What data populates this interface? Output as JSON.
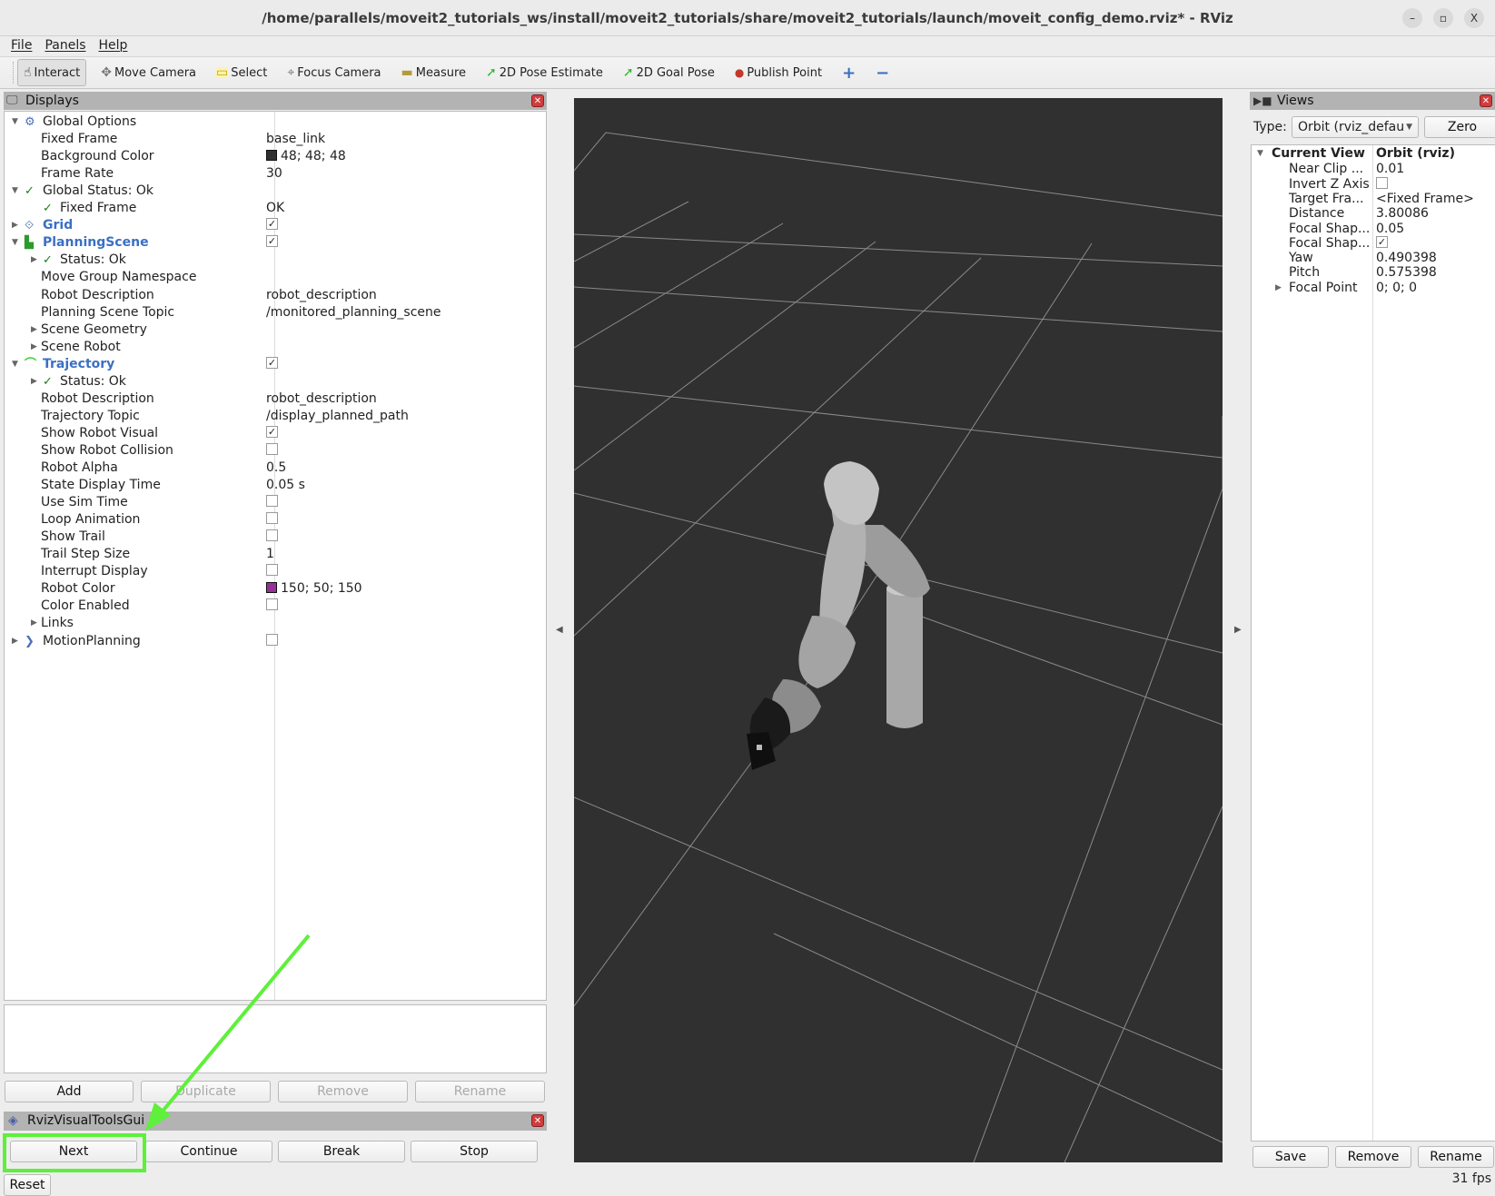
{
  "window": {
    "title": "/home/parallels/moveit2_tutorials_ws/install/moveit2_tutorials/share/moveit2_tutorials/launch/moveit_config_demo.rviz* - RViz",
    "controls": {
      "minimize": "–",
      "maximize": "▫",
      "close": "X"
    }
  },
  "menu": [
    "File",
    "Panels",
    "Help"
  ],
  "toolbar": {
    "tools": [
      {
        "label": "Interact",
        "icon": "hand-pointer-icon",
        "glyph": "☝",
        "active": true
      },
      {
        "label": "Move Camera",
        "icon": "move-camera-icon",
        "glyph": "✥"
      },
      {
        "label": "Select",
        "icon": "select-box-icon",
        "glyph": "▭"
      },
      {
        "label": "Focus Camera",
        "icon": "focus-camera-icon",
        "glyph": "⌖"
      },
      {
        "label": "Measure",
        "icon": "ruler-icon",
        "glyph": "▬"
      },
      {
        "label": "2D Pose Estimate",
        "icon": "pose-arrow-icon",
        "glyph": "➚"
      },
      {
        "label": "2D Goal Pose",
        "icon": "goal-arrow-icon",
        "glyph": "➚"
      },
      {
        "label": "Publish Point",
        "icon": "map-pin-icon",
        "glyph": "📍"
      }
    ],
    "add_tool": "+",
    "remove_tool": "−"
  },
  "displays": {
    "title": "Displays",
    "rows": [
      {
        "level": 0,
        "arrow": "▼",
        "icon": "gear-icon",
        "glyph": "⚙",
        "label": "Global Options",
        "style": "normal"
      },
      {
        "level": 1,
        "label": "Fixed Frame",
        "value": "base_link"
      },
      {
        "level": 1,
        "label": "Background Color",
        "value": "48; 48; 48",
        "swatch": "#303030"
      },
      {
        "level": 1,
        "label": "Frame Rate",
        "value": "30"
      },
      {
        "level": 0,
        "arrow": "▼",
        "icon": "check-icon",
        "glyph": "✓",
        "label": "Global Status: Ok",
        "style": "normal"
      },
      {
        "level": 1,
        "icon": "check-icon",
        "glyph": "✓",
        "label": "Fixed Frame",
        "value": "OK"
      },
      {
        "level": 0,
        "arrow": "▶",
        "icon": "grid-icon",
        "glyph": "⟐",
        "label": "Grid",
        "style": "blue",
        "checkbox": true
      },
      {
        "level": 0,
        "arrow": "▼",
        "icon": "planning-scene-icon",
        "glyph": "▙",
        "label": "PlanningScene",
        "style": "blue",
        "checkbox": true
      },
      {
        "level": 1,
        "arrow": "▶",
        "icon": "check-icon",
        "glyph": "✓",
        "label": "Status: Ok"
      },
      {
        "level": 1,
        "label": "Move Group Namespace",
        "value": ""
      },
      {
        "level": 1,
        "label": "Robot Description",
        "value": "robot_description"
      },
      {
        "level": 1,
        "label": "Planning Scene Topic",
        "value": "/monitored_planning_scene"
      },
      {
        "level": 1,
        "arrow": "▶",
        "label": "Scene Geometry"
      },
      {
        "level": 1,
        "arrow": "▶",
        "label": "Scene Robot"
      },
      {
        "level": 0,
        "arrow": "▼",
        "icon": "trajectory-icon",
        "glyph": "⌒",
        "label": "Trajectory",
        "style": "blue",
        "checkbox": true
      },
      {
        "level": 1,
        "arrow": "▶",
        "icon": "check-icon",
        "glyph": "✓",
        "label": "Status: Ok"
      },
      {
        "level": 1,
        "label": "Robot Description",
        "value": "robot_description"
      },
      {
        "level": 1,
        "label": "Trajectory Topic",
        "value": "/display_planned_path"
      },
      {
        "level": 1,
        "label": "Show Robot Visual",
        "checkbox": true
      },
      {
        "level": 1,
        "label": "Show Robot Collision",
        "checkbox": false
      },
      {
        "level": 1,
        "label": "Robot Alpha",
        "value": "0.5"
      },
      {
        "level": 1,
        "label": "State Display Time",
        "value": "0.05 s"
      },
      {
        "level": 1,
        "label": "Use Sim Time",
        "checkbox": false
      },
      {
        "level": 1,
        "label": "Loop Animation",
        "checkbox": false
      },
      {
        "level": 1,
        "label": "Show Trail",
        "checkbox": false
      },
      {
        "level": 1,
        "label": "Trail Step Size",
        "value": "1"
      },
      {
        "level": 1,
        "label": "Interrupt Display",
        "checkbox": false
      },
      {
        "level": 1,
        "label": "Robot Color",
        "value": "150; 50; 150",
        "swatch": "#963296"
      },
      {
        "level": 1,
        "label": "Color Enabled",
        "checkbox": false
      },
      {
        "level": 1,
        "arrow": "▶",
        "label": "Links"
      },
      {
        "level": 0,
        "arrow": "▶",
        "icon": "motion-planning-icon",
        "glyph": "❯",
        "label": "MotionPlanning",
        "style": "normal",
        "checkbox": false
      }
    ],
    "buttons": {
      "add": "Add",
      "duplicate": "Duplicate",
      "remove": "Remove",
      "rename": "Rename"
    }
  },
  "rviz_visual_tools": {
    "title": "RvizVisualToolsGui",
    "buttons": {
      "next": "Next",
      "continue": "Continue",
      "break": "Break",
      "stop": "Stop",
      "reset": "Reset"
    }
  },
  "views": {
    "title": "Views",
    "type_label": "Type:",
    "type_value": "Orbit (rviz_default_plugins)",
    "type_display": "Orbit (rviz_defau",
    "zero": "Zero",
    "current_view": {
      "label": "Current View",
      "value": "Orbit (rviz)"
    },
    "props": [
      {
        "label": "Near Clip ...",
        "value": "0.01"
      },
      {
        "label": "Invert Z Axis",
        "checkbox": false
      },
      {
        "label": "Target Fra...",
        "value": "<Fixed Frame>"
      },
      {
        "label": "Distance",
        "value": "3.80086"
      },
      {
        "label": "Focal Shap...",
        "value": "0.05"
      },
      {
        "label": "Focal Shap...",
        "checkbox": true
      },
      {
        "label": "Yaw",
        "value": "0.490398"
      },
      {
        "label": "Pitch",
        "value": "0.575398"
      },
      {
        "label": "Focal Point",
        "value": "0; 0; 0",
        "arrow": "▶"
      }
    ],
    "buttons": {
      "save": "Save",
      "remove": "Remove",
      "rename": "Rename"
    }
  },
  "status": {
    "fps": "31 fps"
  },
  "colors": {
    "viewport_bg": "#303030",
    "grid_line": "#8a8a8a",
    "annotation_green": "#5ef03a",
    "display_blue": "#3b6fc4"
  }
}
